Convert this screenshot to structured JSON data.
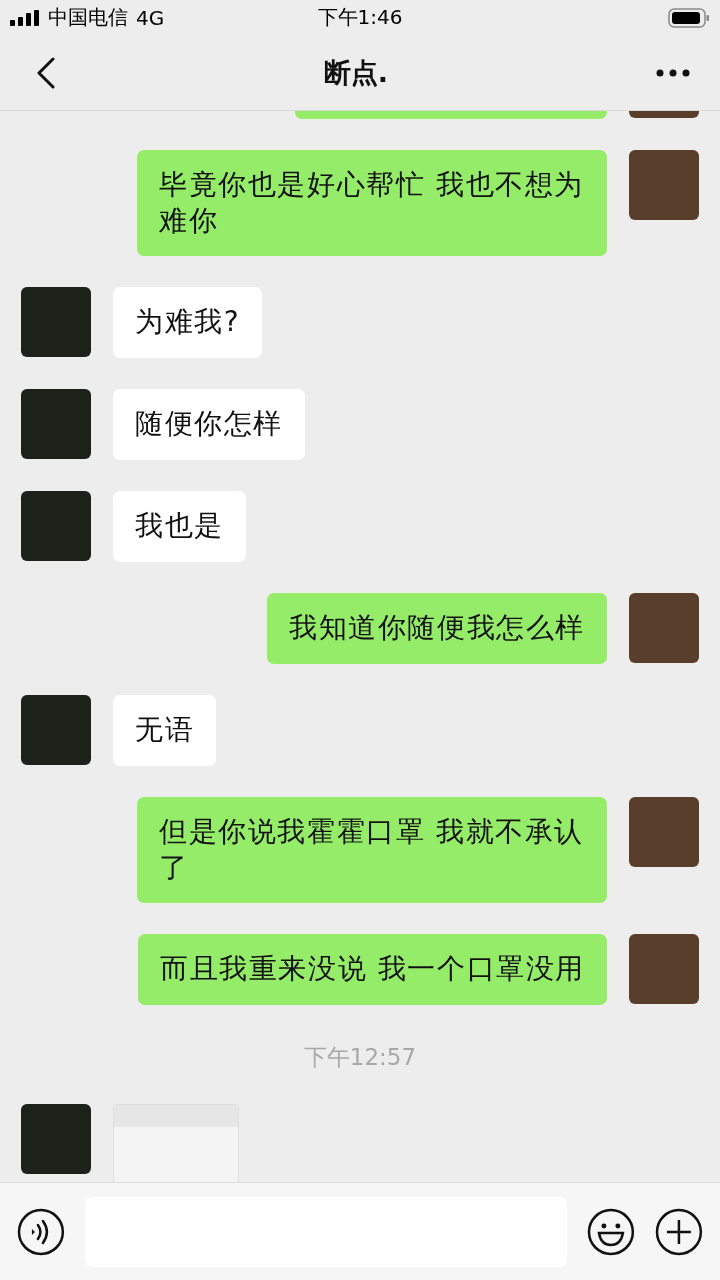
{
  "status_bar": {
    "carrier": "中国电信",
    "network": "4G",
    "time": "下午1:46"
  },
  "header": {
    "title": "断点."
  },
  "messages": [
    {
      "kind": "text",
      "sent": true
    },
    {
      "kind": "text",
      "sent": true,
      "text": "毕竟你也是好心帮忙 我也不想为难你"
    },
    {
      "kind": "text",
      "sent": false,
      "text": "为难我?"
    },
    {
      "kind": "text",
      "sent": false,
      "text": "随便你怎样"
    },
    {
      "kind": "text",
      "sent": false,
      "text": "我也是"
    },
    {
      "kind": "text",
      "sent": true,
      "text": "我知道你随便我怎么样"
    },
    {
      "kind": "text",
      "sent": false,
      "text": "无语"
    },
    {
      "kind": "text",
      "sent": true,
      "text": "但是你说我霍霍口罩 我就不承认了"
    },
    {
      "kind": "text",
      "sent": true,
      "text": "而且我重来没说 我一个口罩没用"
    },
    {
      "kind": "time",
      "text": "下午12:57"
    },
    {
      "kind": "image",
      "sent": false
    }
  ]
}
